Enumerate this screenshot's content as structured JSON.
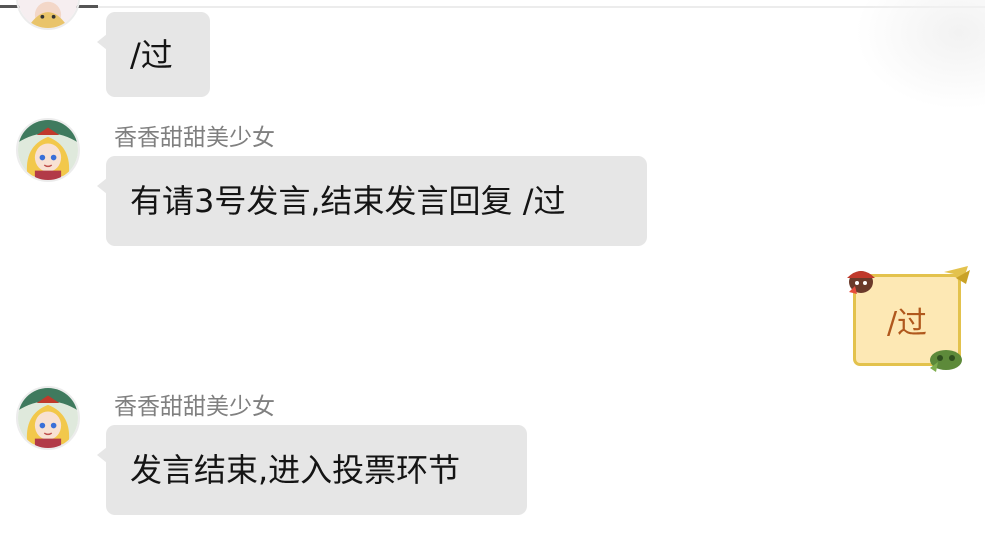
{
  "messages": [
    {
      "side": "left",
      "sender": "",
      "text": "/过"
    },
    {
      "side": "left",
      "sender": "香香甜甜美少女",
      "text": "有请3号发言,结束发言回复 /过"
    },
    {
      "side": "right",
      "sender": "",
      "text": "/过"
    },
    {
      "side": "left",
      "sender": "香香甜甜美少女",
      "text": "发言结束,进入投票环节"
    }
  ],
  "colors": {
    "bubble_bg": "#e6e6e6",
    "bubble_text": "#141414",
    "nickname": "#808080",
    "self_bubble_bg": "#fde8b4",
    "self_bubble_border": "#e3c24d",
    "self_bubble_text": "#b0581d"
  },
  "icons": [
    "avatar-anime-girl",
    "self-bubble-frame-decoration"
  ]
}
